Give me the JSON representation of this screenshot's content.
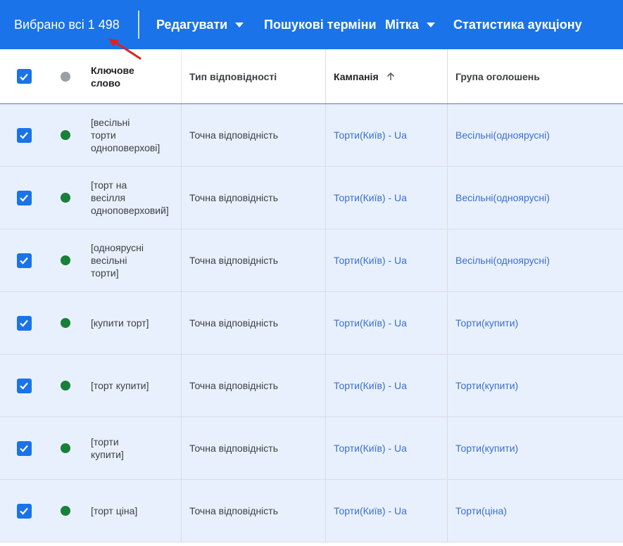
{
  "topbar": {
    "selection_text": "Вибрано всі 1 498",
    "menu": {
      "edit": "Редагувати",
      "search_terms": "Пошукові терміни",
      "label": "Мітка",
      "auction_stats": "Статистика аукціону"
    }
  },
  "table": {
    "headers": {
      "keyword": "Ключове\nслово",
      "match_type": "Тип відповідності",
      "campaign": "Кампанія",
      "ad_group": "Група оголошень"
    },
    "rows": [
      {
        "keyword": "[весільні\nторти\nодноповерхові]",
        "match_type": "Точна відповідність",
        "campaign": "Торти(Київ) - Ua",
        "ad_group": "Весільні(одноярусні)"
      },
      {
        "keyword": "[торт на\nвесілля\nодноповерховий]",
        "match_type": "Точна відповідність",
        "campaign": "Торти(Київ) - Ua",
        "ad_group": "Весільні(одноярусні)"
      },
      {
        "keyword": "[одноярусні\nвесільні\nторти]",
        "match_type": "Точна відповідність",
        "campaign": "Торти(Київ) - Ua",
        "ad_group": "Весільні(одноярусні)"
      },
      {
        "keyword": "[купити торт]",
        "match_type": "Точна відповідність",
        "campaign": "Торти(Київ) - Ua",
        "ad_group": "Торти(купити)"
      },
      {
        "keyword": "[торт купити]",
        "match_type": "Точна відповідність",
        "campaign": "Торти(Київ) - Ua",
        "ad_group": "Торти(купити)"
      },
      {
        "keyword": "[торти\nкупити]",
        "match_type": "Точна відповідність",
        "campaign": "Торти(Київ) - Ua",
        "ad_group": "Торти(купити)"
      },
      {
        "keyword": "[торт ціна]",
        "match_type": "Точна відповідність",
        "campaign": "Торти(Київ) - Ua",
        "ad_group": "Торти(ціна)"
      }
    ]
  },
  "colors": {
    "primary": "#1a73e8",
    "status_enabled": "#188038",
    "status_header": "#9aa0a6",
    "selected_row": "#e8f0fd",
    "link": "#3a6fd1",
    "annotation_arrow": "#e02020"
  },
  "icons": {
    "checkbox": "checkbox-checked-icon",
    "sort": "arrow-up-icon",
    "dropdown": "caret-down-icon",
    "annotation": "red-arrow-icon"
  }
}
